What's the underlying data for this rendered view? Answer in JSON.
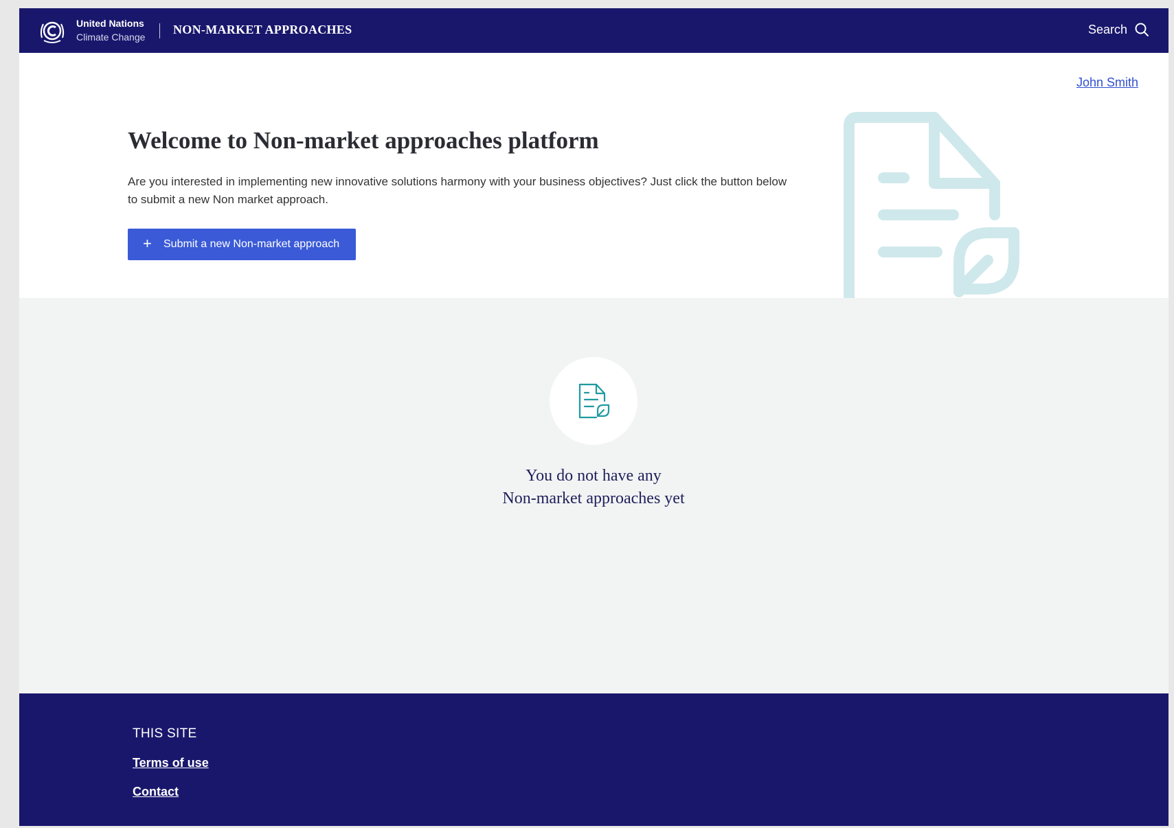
{
  "header": {
    "logo": {
      "org_line1": "United Nations",
      "org_line2": "Climate Change",
      "icon": "un-climate-emblem"
    },
    "app_title": "NON-MARKET APPROACHES",
    "search_label": "Search",
    "search_icon": "search-icon"
  },
  "hero": {
    "user_name": "John Smith",
    "title": "Welcome to Non-market approaches platform",
    "description": "Are you interested in implementing new innovative solutions harmony with your business objectives? Just click the button below to submit a new Non market approach.",
    "submit_button": {
      "icon": "plus",
      "label": "Submit a new Non-market approach"
    },
    "illustration_icon": "document-leaf-icon"
  },
  "empty_state": {
    "icon": "document-leaf-icon",
    "line1": "You do not have any",
    "line2": "Non-market approaches yet"
  },
  "footer": {
    "heading": "THIS SITE",
    "links": [
      "Terms of use",
      "Contact"
    ]
  },
  "colors": {
    "navy": "#19176c",
    "button_blue": "#3a5ad7",
    "link_blue": "#2f4fcf",
    "teal_icon": "#1e9aa0",
    "illustration": "#cfe8ec",
    "content_bg": "#f2f4f4"
  }
}
